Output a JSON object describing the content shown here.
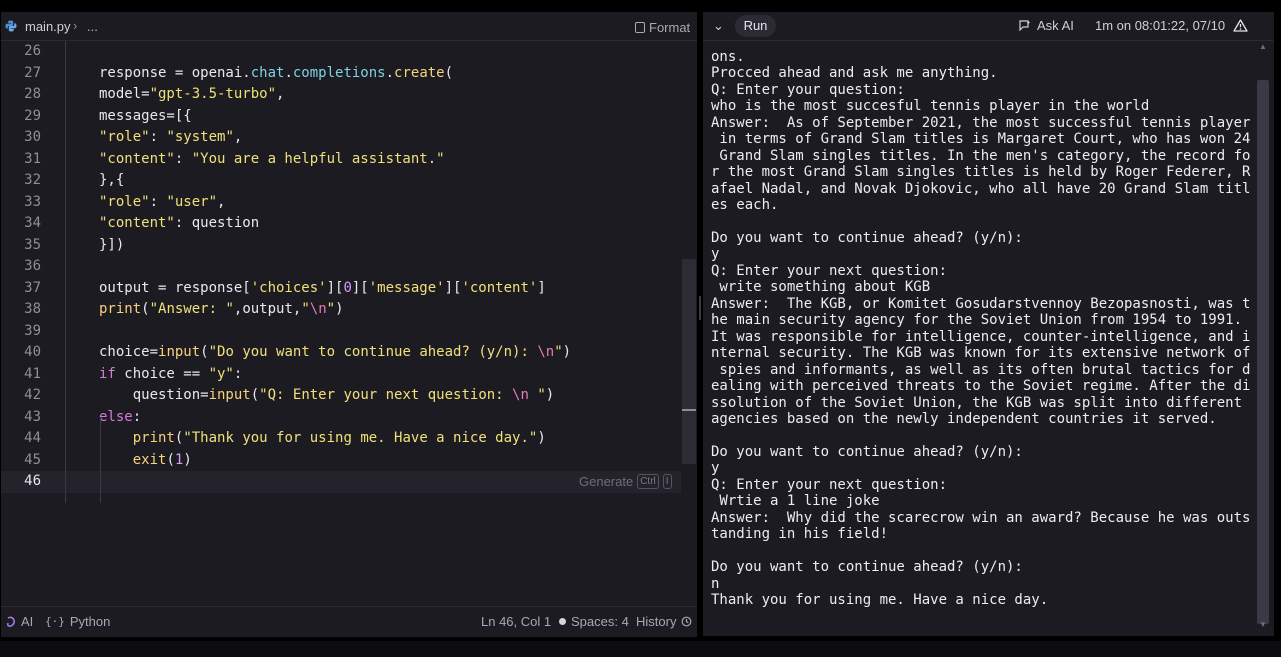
{
  "editor": {
    "file_name": "main.py",
    "breadcrumb_more": "...",
    "format_label": "Format",
    "generate_label": "Generate",
    "generate_key1": "Ctrl",
    "generate_key2": "I",
    "lines": [
      {
        "n": "26"
      },
      {
        "n": "27",
        "tokens": [
          [
            "",
            "response = openai."
          ],
          [
            "attr",
            "chat"
          ],
          [
            "",
            "."
          ],
          [
            "attr",
            "completions"
          ],
          [
            "",
            "."
          ],
          [
            "fn",
            "create"
          ],
          [
            "",
            "("
          ]
        ]
      },
      {
        "n": "28",
        "tokens": [
          [
            "",
            "model="
          ],
          [
            "str",
            "\"gpt-3.5-turbo\""
          ],
          [
            "",
            ","
          ]
        ]
      },
      {
        "n": "29",
        "tokens": [
          [
            "",
            "messages=[{"
          ]
        ]
      },
      {
        "n": "30",
        "tokens": [
          [
            "str",
            "\"role\""
          ],
          [
            "",
            ": "
          ],
          [
            "str",
            "\"system\""
          ],
          [
            "",
            ","
          ]
        ]
      },
      {
        "n": "31",
        "tokens": [
          [
            "str",
            "\"content\""
          ],
          [
            "",
            ": "
          ],
          [
            "str",
            "\"You are a helpful assistant.\""
          ]
        ]
      },
      {
        "n": "32",
        "tokens": [
          [
            "",
            "},{"
          ]
        ]
      },
      {
        "n": "33",
        "tokens": [
          [
            "str",
            "\"role\""
          ],
          [
            "",
            ": "
          ],
          [
            "str",
            "\"user\""
          ],
          [
            "",
            ","
          ]
        ]
      },
      {
        "n": "34",
        "tokens": [
          [
            "str",
            "\"content\""
          ],
          [
            "",
            ": question"
          ]
        ]
      },
      {
        "n": "35",
        "tokens": [
          [
            "",
            "}])"
          ]
        ]
      },
      {
        "n": "36"
      },
      {
        "n": "37",
        "tokens": [
          [
            "",
            "output = response["
          ],
          [
            "str",
            "'choices'"
          ],
          [
            "",
            "]["
          ],
          [
            "num",
            "0"
          ],
          [
            "",
            "]["
          ],
          [
            "str",
            "'message'"
          ],
          [
            "",
            "]["
          ],
          [
            "str",
            "'content'"
          ],
          [
            "",
            "]"
          ]
        ]
      },
      {
        "n": "38",
        "tokens": [
          [
            "fn",
            "print"
          ],
          [
            "",
            "("
          ],
          [
            "str",
            "\"Answer: \""
          ],
          [
            "",
            ",output,"
          ],
          [
            "str",
            "\""
          ],
          [
            "esc",
            "\\n"
          ],
          [
            "str",
            "\""
          ],
          [
            "",
            ")"
          ]
        ]
      },
      {
        "n": "39"
      },
      {
        "n": "40",
        "tokens": [
          [
            "",
            "choice="
          ],
          [
            "fn",
            "input"
          ],
          [
            "",
            "("
          ],
          [
            "str",
            "\"Do you want to continue ahead? (y/n): "
          ],
          [
            "esc",
            "\\n"
          ],
          [
            "str",
            "\""
          ],
          [
            "",
            ")"
          ]
        ]
      },
      {
        "n": "41",
        "tokens": [
          [
            "kw",
            "if"
          ],
          [
            "",
            " choice == "
          ],
          [
            "str",
            "\"y\""
          ],
          [
            "",
            ":"
          ]
        ]
      },
      {
        "n": "42",
        "tokens": [
          [
            "",
            "    question="
          ],
          [
            "fn",
            "input"
          ],
          [
            "",
            "("
          ],
          [
            "str",
            "\"Q: Enter your next question: "
          ],
          [
            "esc",
            "\\n"
          ],
          [
            "str",
            " \""
          ],
          [
            "",
            ")"
          ]
        ]
      },
      {
        "n": "43",
        "tokens": [
          [
            "kw",
            "else"
          ],
          [
            "",
            ":"
          ]
        ]
      },
      {
        "n": "44",
        "tokens": [
          [
            "",
            "    "
          ],
          [
            "fn",
            "print"
          ],
          [
            "",
            "("
          ],
          [
            "str",
            "\"Thank you for using me. Have a nice day.\""
          ],
          [
            "",
            ")"
          ]
        ]
      },
      {
        "n": "45",
        "tokens": [
          [
            "",
            "    "
          ],
          [
            "fn",
            "exit"
          ],
          [
            "",
            "("
          ],
          [
            "num",
            "1"
          ],
          [
            "",
            ")"
          ]
        ]
      },
      {
        "n": "46",
        "active": true
      }
    ]
  },
  "status_bar": {
    "ai_label": "AI",
    "language_label": "Python",
    "cursor_position": "Ln 46, Col 1",
    "spaces": "Spaces: 4",
    "history_label": "History"
  },
  "console": {
    "run_label": "Run",
    "ask_ai_label": "Ask AI",
    "run_info": "1m on 08:01:22, 07/10",
    "output_lines": [
      "ons.",
      "Procced ahead and ask me anything.",
      "Q: Enter your question:",
      "who is the most succesful tennis player in the world",
      "Answer:  As of September 2021, the most successful tennis player",
      " in terms of Grand Slam titles is Margaret Court, who has won 24",
      " Grand Slam singles titles. In the men's category, the record fo",
      "r the most Grand Slam singles titles is held by Roger Federer, R",
      "afael Nadal, and Novak Djokovic, who all have 20 Grand Slam titl",
      "es each.",
      "",
      "Do you want to continue ahead? (y/n):",
      "y",
      "Q: Enter your next question:",
      " write something about KGB",
      "Answer:  The KGB, or Komitet Gosudarstvennoy Bezopasnosti, was t",
      "he main security agency for the Soviet Union from 1954 to 1991.",
      "It was responsible for intelligence, counter-intelligence, and i",
      "nternal security. The KGB was known for its extensive network of",
      " spies and informants, as well as its often brutal tactics for d",
      "ealing with perceived threats to the Soviet regime. After the di",
      "ssolution of the Soviet Union, the KGB was split into different",
      "agencies based on the newly independent countries it served.",
      "",
      "Do you want to continue ahead? (y/n):",
      "y",
      "Q: Enter your next question:",
      " Wrtie a 1 line joke",
      "Answer:  Why did the scarecrow win an award? Because he was outs",
      "tanding in his field!",
      "",
      "Do you want to continue ahead? (y/n):",
      "n",
      "Thank you for using me. Have a nice day."
    ]
  },
  "icons": {
    "file": "python-icon",
    "format": "format-icon",
    "ask_ai": "ask-ai-icon",
    "warning": "warning-icon",
    "history": "history-icon",
    "ai": "ai-icon",
    "language": "braces-icon",
    "collapse": "chevron-down-icon"
  },
  "colors": {
    "background": "#1c1b22",
    "string": "#f0e07a",
    "function": "#f7d27a",
    "attribute": "#7fd2e0",
    "keyword": "#d77ad6",
    "number": "#d59cff"
  }
}
